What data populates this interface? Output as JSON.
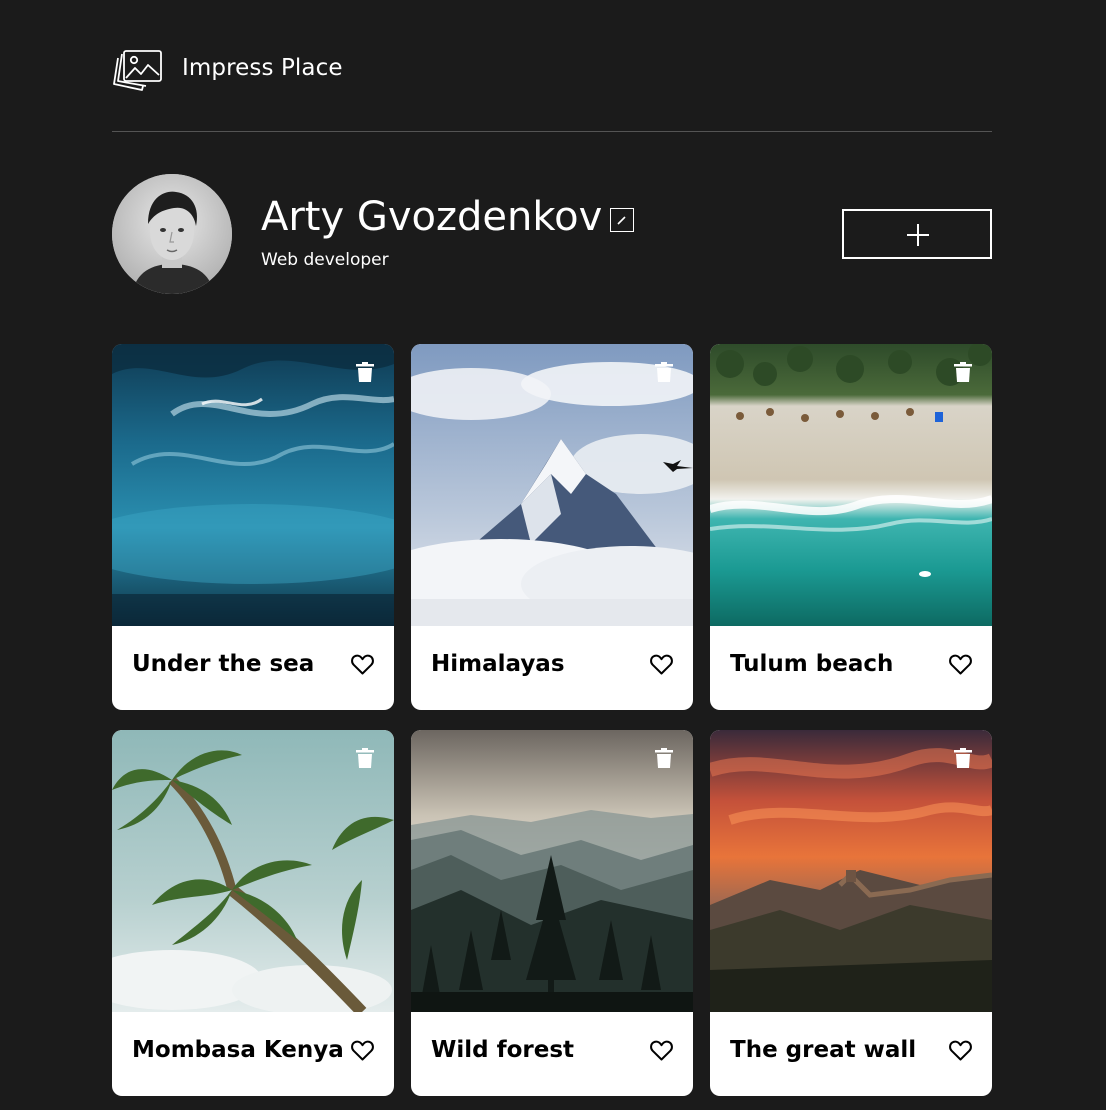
{
  "header": {
    "logo_icon": "photo-stack-icon",
    "logo_text": "Impress Place"
  },
  "profile": {
    "name": "Arty Gvozdenkov",
    "role": "Web developer",
    "edit_icon": "pencil-icon",
    "add_icon": "plus-icon"
  },
  "cards": [
    {
      "title": "Under the sea",
      "image": "underwater-waves",
      "liked": false
    },
    {
      "title": "Himalayas",
      "image": "snowy-mountain-peak",
      "liked": false
    },
    {
      "title": "Tulum beach",
      "image": "aerial-beach",
      "liked": false
    },
    {
      "title": "Mombasa Kenya",
      "image": "palm-trees",
      "liked": false
    },
    {
      "title": "Wild forest",
      "image": "misty-forest-mountains",
      "liked": false
    },
    {
      "title": "The great wall",
      "image": "great-wall-sunset",
      "liked": false
    }
  ],
  "colors": {
    "background": "#1b1b1b",
    "card": "#ffffff",
    "text_dark": "#000000",
    "divider": "#545454"
  }
}
